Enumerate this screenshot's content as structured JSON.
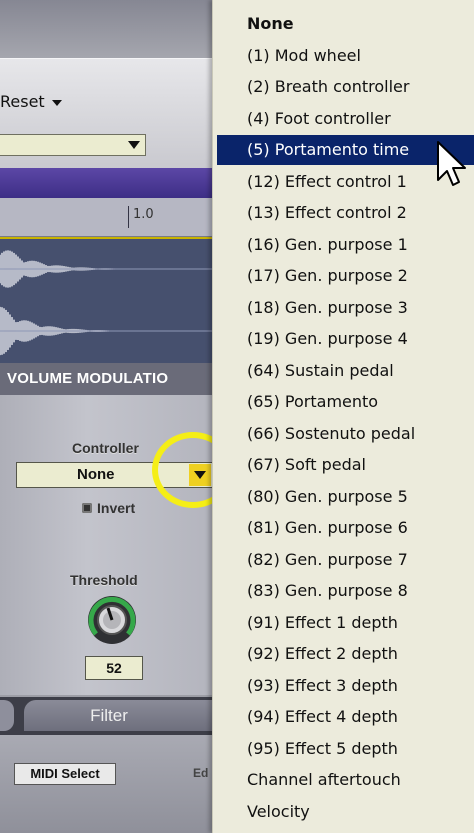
{
  "app": {
    "reset_label": "Reset",
    "ruler_label": "1.0",
    "section_title": "VOLUME MODULATIO",
    "controller": {
      "label": "Controller",
      "value": "None"
    },
    "invert_label": "Invert",
    "threshold": {
      "label": "Threshold",
      "value": "52"
    },
    "tabs": {
      "filter_label": "Filter"
    },
    "midi_select_label": "MIDI Select",
    "edit_label": "Ed"
  },
  "menu": {
    "items": [
      {
        "label": "None",
        "bold": true
      },
      {
        "label": "(1) Mod wheel"
      },
      {
        "label": "(2) Breath controller"
      },
      {
        "label": "(4) Foot controller"
      },
      {
        "label": "(5) Portamento time",
        "selected": true
      },
      {
        "label": "(12) Effect control 1"
      },
      {
        "label": "(13) Effect control 2"
      },
      {
        "label": "(16) Gen. purpose 1"
      },
      {
        "label": "(17) Gen. purpose 2"
      },
      {
        "label": "(18) Gen. purpose 3"
      },
      {
        "label": "(19) Gen. purpose 4"
      },
      {
        "label": "(64) Sustain pedal"
      },
      {
        "label": "(65) Portamento"
      },
      {
        "label": "(66) Sostenuto pedal"
      },
      {
        "label": "(67) Soft pedal"
      },
      {
        "label": "(80) Gen. purpose 5"
      },
      {
        "label": "(81) Gen. purpose 6"
      },
      {
        "label": "(82) Gen. purpose 7"
      },
      {
        "label": "(83) Gen. purpose 8"
      },
      {
        "label": "(91) Effect 1 depth"
      },
      {
        "label": "(92) Effect 2 depth"
      },
      {
        "label": "(93) Effect 3 depth"
      },
      {
        "label": "(94) Effect 4 depth"
      },
      {
        "label": "(95) Effect 5 depth"
      },
      {
        "label": "Channel aftertouch"
      },
      {
        "label": "Velocity"
      }
    ]
  },
  "colors": {
    "menu_background": "#ecebdc",
    "menu_selected": "#0a246a",
    "highlight_circle": "#f5ee16",
    "dropdown_button": "#efd021"
  },
  "icons": [
    "dropdown-arrow-icon",
    "checkbox-icon",
    "knob-icon",
    "cursor-icon"
  ]
}
